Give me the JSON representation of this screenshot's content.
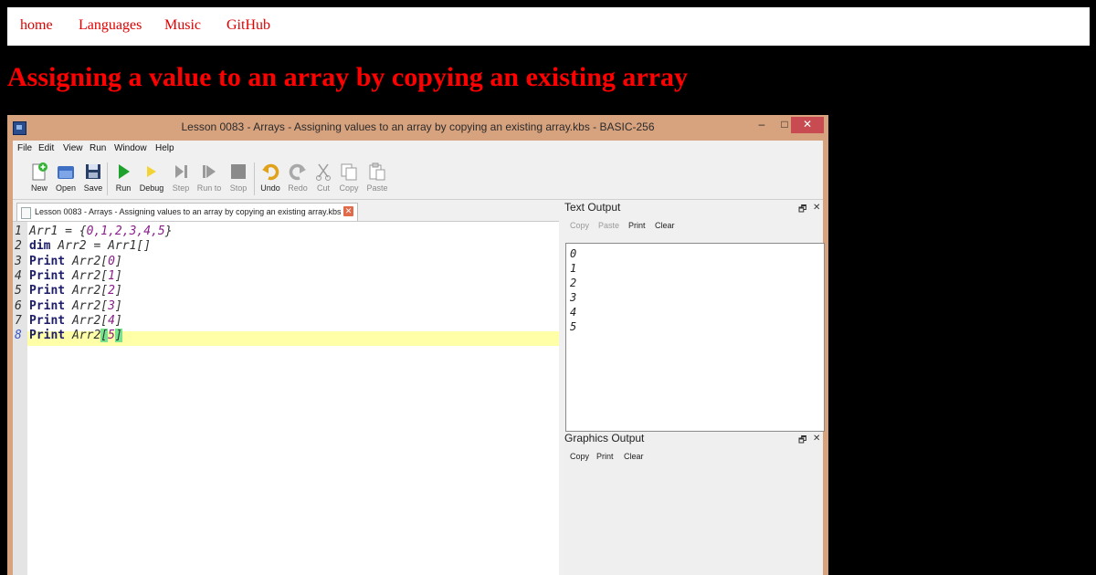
{
  "nav": {
    "items": [
      "home",
      "Languages",
      "Music",
      "GitHub"
    ]
  },
  "page": {
    "title": "Assigning a value to an array by copying an existing array"
  },
  "window": {
    "title": "Lesson 0083 - Arrays - Assigning values to an array by copying an existing array.kbs - BASIC-256",
    "controls": {
      "minimize": "–",
      "maximize": "□",
      "close": "✕"
    },
    "menu": [
      "File",
      "Edit",
      "View",
      "Run",
      "Window",
      "Help"
    ],
    "toolbar": [
      {
        "label": "New",
        "icon": "new-file-icon",
        "enabled": true
      },
      {
        "label": "Open",
        "icon": "open-folder-icon",
        "enabled": true
      },
      {
        "label": "Save",
        "icon": "save-disk-icon",
        "enabled": true
      },
      {
        "label": "Run",
        "icon": "run-play-icon",
        "enabled": true
      },
      {
        "label": "Debug",
        "icon": "debug-icon",
        "enabled": true
      },
      {
        "label": "Step",
        "icon": "step-icon",
        "enabled": false
      },
      {
        "label": "Run to",
        "icon": "run-to-icon",
        "enabled": false
      },
      {
        "label": "Stop",
        "icon": "stop-icon",
        "enabled": false
      },
      {
        "label": "Undo",
        "icon": "undo-icon",
        "enabled": true
      },
      {
        "label": "Redo",
        "icon": "redo-icon",
        "enabled": false
      },
      {
        "label": "Cut",
        "icon": "cut-scissors-icon",
        "enabled": false
      },
      {
        "label": "Copy",
        "icon": "copy-icon",
        "enabled": false
      },
      {
        "label": "Paste",
        "icon": "paste-icon",
        "enabled": false
      }
    ],
    "tab": {
      "label": "Lesson 0083 - Arrays - Assigning values to an array by copying an existing array.kbs",
      "close": "✕"
    }
  },
  "editor": {
    "current_line": 8,
    "lines": [
      {
        "n": "1",
        "parts": [
          {
            "t": "Arr1 = {",
            "c": "id"
          },
          {
            "t": "0,1,2,3,4,5",
            "c": "num"
          },
          {
            "t": "}",
            "c": "id"
          }
        ]
      },
      {
        "n": "2",
        "parts": [
          {
            "t": "dim",
            "c": "kw"
          },
          {
            "t": " Arr2 = Arr1[]",
            "c": "id"
          }
        ]
      },
      {
        "n": "3",
        "parts": [
          {
            "t": "Print",
            "c": "kw"
          },
          {
            "t": " Arr2[",
            "c": "id"
          },
          {
            "t": "0",
            "c": "num"
          },
          {
            "t": "]",
            "c": "id"
          }
        ]
      },
      {
        "n": "4",
        "parts": [
          {
            "t": "Print",
            "c": "kw"
          },
          {
            "t": " Arr2[",
            "c": "id"
          },
          {
            "t": "1",
            "c": "num"
          },
          {
            "t": "]",
            "c": "id"
          }
        ]
      },
      {
        "n": "5",
        "parts": [
          {
            "t": "Print",
            "c": "kw"
          },
          {
            "t": " Arr2[",
            "c": "id"
          },
          {
            "t": "2",
            "c": "num"
          },
          {
            "t": "]",
            "c": "id"
          }
        ]
      },
      {
        "n": "6",
        "parts": [
          {
            "t": "Print",
            "c": "kw"
          },
          {
            "t": " Arr2[",
            "c": "id"
          },
          {
            "t": "3",
            "c": "num"
          },
          {
            "t": "]",
            "c": "id"
          }
        ]
      },
      {
        "n": "7",
        "parts": [
          {
            "t": "Print",
            "c": "kw"
          },
          {
            "t": " Arr2[",
            "c": "id"
          },
          {
            "t": "4",
            "c": "num"
          },
          {
            "t": "]",
            "c": "id"
          }
        ]
      },
      {
        "n": "8",
        "parts": [
          {
            "t": "Print",
            "c": "kw"
          },
          {
            "t": " Arr2",
            "c": "id"
          },
          {
            "t": "[",
            "c": "id brk"
          },
          {
            "t": "5",
            "c": "num"
          },
          {
            "t": "]",
            "c": "id brk"
          }
        ]
      }
    ]
  },
  "text_output": {
    "title": "Text Output",
    "buttons": [
      {
        "label": "Copy",
        "enabled": false
      },
      {
        "label": "Paste",
        "enabled": false
      },
      {
        "label": "Print",
        "enabled": true
      },
      {
        "label": "Clear",
        "enabled": true
      }
    ],
    "lines": [
      "0",
      "1",
      "2",
      "3",
      "4",
      "5"
    ]
  },
  "graphics_output": {
    "title": "Graphics Output",
    "buttons": [
      {
        "label": "Copy",
        "enabled": true
      },
      {
        "label": "Print",
        "enabled": true
      },
      {
        "label": "Clear",
        "enabled": true
      }
    ]
  },
  "panel_controls": {
    "float": "🗗",
    "close": "✕"
  },
  "colors": {
    "accent_red": "#ff0000",
    "window_frame": "#d7a27e",
    "close_button": "#c74b50",
    "current_line": "#ffffa8",
    "brace_match": "#77e38f"
  }
}
